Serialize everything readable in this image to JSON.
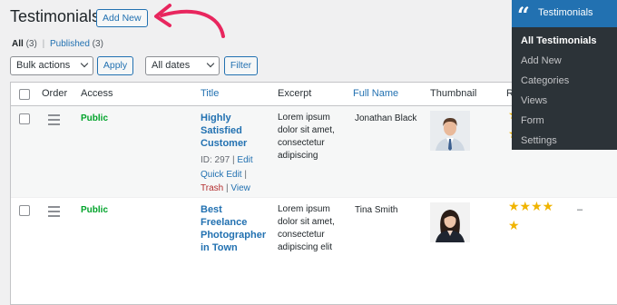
{
  "header": {
    "title": "Testimonials",
    "add_new": "Add New"
  },
  "views": {
    "all_label": "All",
    "all_count": "(3)",
    "sep": "|",
    "published_label": "Published",
    "published_count": "(3)"
  },
  "bulk": {
    "selected": "Bulk actions",
    "apply": "Apply"
  },
  "dates": {
    "selected": "All dates",
    "filter": "Filter"
  },
  "columns": {
    "order": "Order",
    "access": "Access",
    "title": "Title",
    "excerpt": "Excerpt",
    "full_name": "Full Name",
    "thumbnail": "Thumbnail",
    "rating": "Ra"
  },
  "rows": [
    {
      "access": "Public",
      "title_lines": [
        "Highly",
        "Satisfied",
        "Customer"
      ],
      "id_text": "ID: 297 |",
      "edit": "Edit",
      "bar": "|",
      "quick_edit": "Quick Edit",
      "trash": "Trash",
      "view": "View",
      "excerpt_lines": [
        "Lorem ipsum",
        "dolor sit amet,",
        "consectetur",
        "adipiscing"
      ],
      "full_name": "Jonathan Black",
      "thumbnail_icon": "man-portrait-icon",
      "stars_visible": "★\n★"
    },
    {
      "access": "Public",
      "title_lines": [
        "Best",
        "Freelance",
        "Photographer",
        "in Town"
      ],
      "excerpt_lines": [
        "Lorem ipsum",
        "dolor sit amet,",
        "consectetur",
        "adipiscing elit"
      ],
      "full_name": "Tina Smith",
      "thumbnail_icon": "woman-portrait-icon",
      "rating": 5,
      "stars_line1": "★★★★",
      "stars_line2": "★",
      "dash": "–"
    }
  ],
  "menu": {
    "header": "Testimonials",
    "items": [
      "All Testimonials",
      "Add New",
      "Categories",
      "Views",
      "Form",
      "Settings"
    ]
  },
  "colors": {
    "accent": "#2271b1",
    "public": "#00a32a",
    "star": "#f0b400",
    "annotation_arrow": "#e8265e",
    "menu_bg": "#2c3338"
  }
}
